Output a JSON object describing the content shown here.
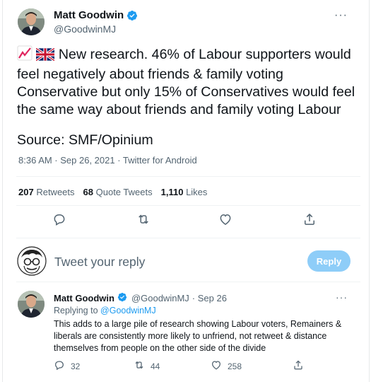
{
  "tweet": {
    "author_name": "Matt Goodwin",
    "author_handle": "@GoodwinMJ",
    "more_label": "···",
    "text": "New research. 46% of Labour supporters would feel negatively about friends & family voting Conservative but only 15% of Conservatives would feel the same way about friends and family voting Labour",
    "source_line": "Source: SMF/Opinium",
    "timestamp": "8:36 AM · Sep 26, 2021 · Twitter for Android",
    "emoji": [
      "chart-increasing-icon",
      "uk-flag-icon"
    ],
    "stats": {
      "retweets_count": "207",
      "retweets_label": "Retweets",
      "quotes_count": "68",
      "quotes_label": "Quote Tweets",
      "likes_count": "1,110",
      "likes_label": "Likes"
    },
    "action_icons": [
      "reply-icon",
      "retweet-icon",
      "like-icon",
      "share-icon"
    ]
  },
  "reply_box": {
    "placeholder": "Tweet your reply",
    "button_label": "Reply",
    "button_color": "#8ecdf8"
  },
  "reply_tweet": {
    "author_name": "Matt Goodwin",
    "author_handle": "@GoodwinMJ",
    "date": "· Sep 26",
    "more_label": "···",
    "replying_prefix": "Replying to",
    "replying_to": "@GoodwinMJ",
    "text": "This adds to a large pile of research showing Labour voters, Remainers & liberals are consistently more likely to unfriend, not retweet & distance themselves from people on the other side of the divide",
    "replies": "32",
    "retweets": "44",
    "likes": "258"
  },
  "colors": {
    "accent": "#1d9bf0",
    "text": "#0f1419",
    "secondary": "#536471"
  }
}
